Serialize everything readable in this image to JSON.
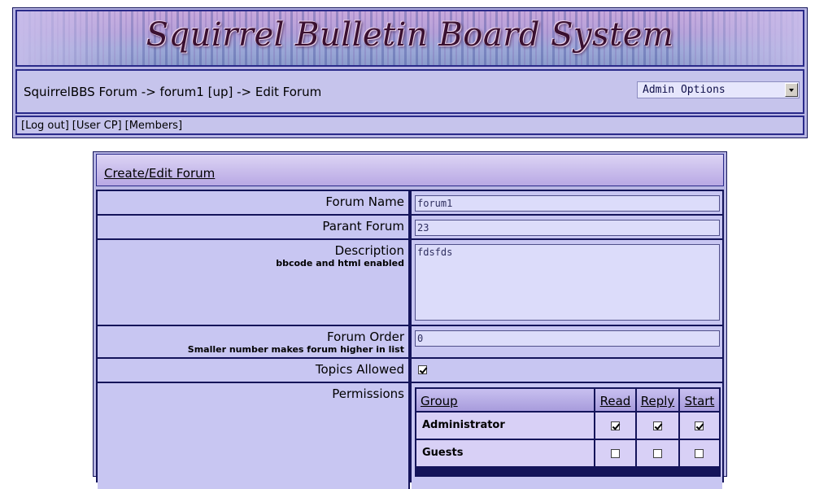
{
  "header": {
    "site_title": "Squirrel Bulletin Board System",
    "breadcrumb": "SquirrelBBS Forum -> forum1 [up] -> Edit Forum",
    "admin_select": {
      "selected": "Admin Options"
    },
    "user_links": [
      "[Log out]",
      "[User CP]",
      "[Members]"
    ]
  },
  "panel": {
    "title": "Create/Edit Forum",
    "fields": {
      "forum_name": {
        "label": "Forum Name",
        "value": "forum1"
      },
      "parent_forum": {
        "label": "Parant Forum",
        "value": "23"
      },
      "description": {
        "label": "Description",
        "hint": "bbcode and html enabled",
        "value": "fdsfds"
      },
      "forum_order": {
        "label": "Forum Order",
        "hint": "Smaller number makes forum higher in list",
        "value": "0"
      },
      "topics_allowed": {
        "label": "Topics Allowed",
        "checked": true
      },
      "permissions": {
        "label": "Permissions"
      }
    },
    "permissions_table": {
      "headers": [
        "Group",
        "Read",
        "Reply",
        "Start"
      ],
      "rows": [
        {
          "group": "Administrator",
          "read": true,
          "reply": true,
          "start": true
        },
        {
          "group": "Guests",
          "read": false,
          "reply": false,
          "start": false
        }
      ]
    }
  }
}
